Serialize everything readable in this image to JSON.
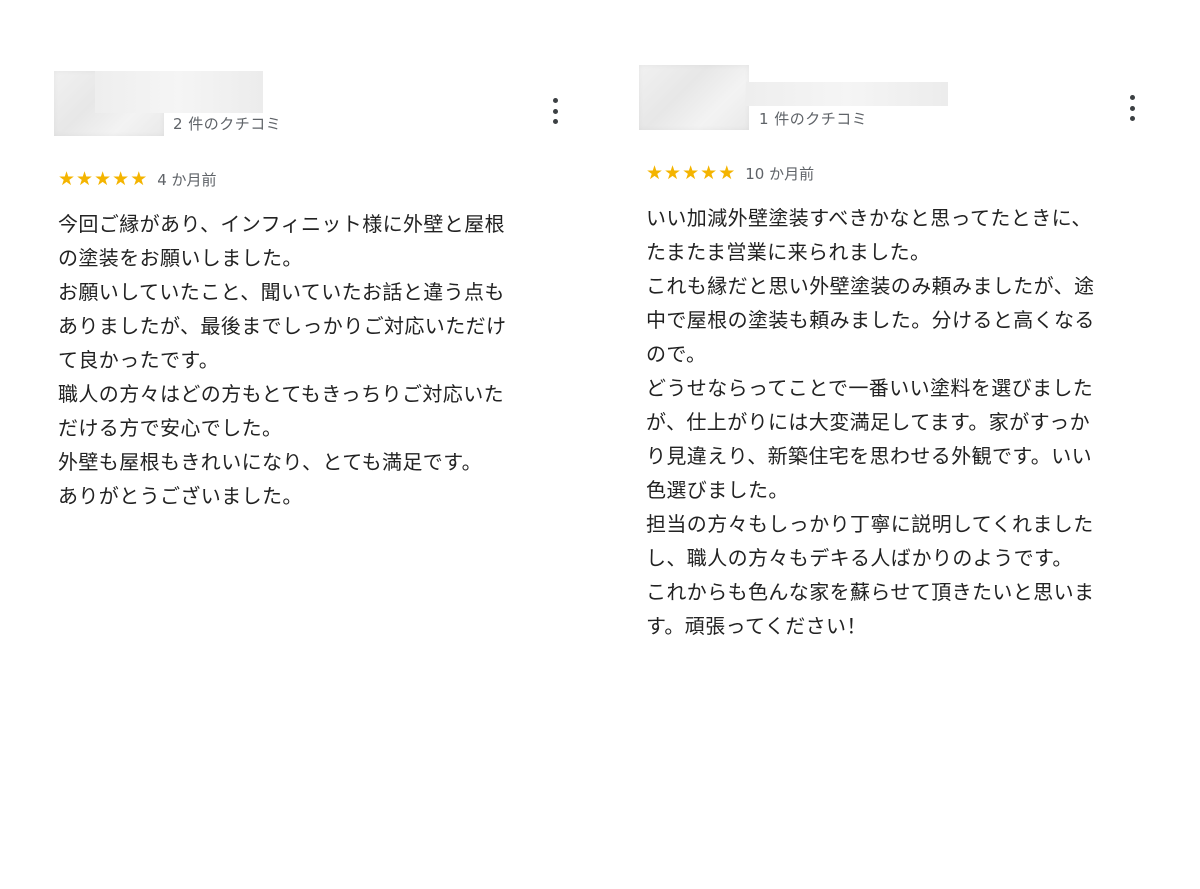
{
  "reviews": [
    {
      "review_count": "2 件のクチコミ",
      "rating": 5,
      "date": "4 か月前",
      "lines": [
        "今回ご縁があり、インフィニット様に外壁と屋根",
        "の塗装をお願いしました。",
        "お願いしていたこと、聞いていたお話と違う点も",
        "ありましたが、最後までしっかりご対応いただけ",
        "て良かったです。",
        "職人の方々はどの方もとてもきっちりご対応いた",
        "だける方で安心でした。",
        "外壁も屋根もきれいになり、とても満足です。",
        "ありがとうございました。"
      ]
    },
    {
      "review_count": "1 件のクチコミ",
      "rating": 5,
      "date": "10 か月前",
      "lines": [
        "いい加減外壁塗装すべきかなと思ってたときに、",
        "たまたま営業に来られました。",
        "これも縁だと思い外壁塗装のみ頼みましたが、途",
        "中で屋根の塗装も頼みました。分けると高くなる",
        "ので。",
        "どうせならってことで一番いい塗料を選びました",
        "が、仕上がりには大変満足してます。家がすっか",
        "り見違えり、新築住宅を思わせる外観です。いい",
        "色選びました。",
        "担当の方々もしっかり丁寧に説明してくれました",
        "し、職人の方々もデキる人ばかりのようです。",
        "これからも色んな家を蘇らせて頂きたいと思いま",
        "す。頑張ってください！"
      ]
    }
  ],
  "icons": {
    "star": "★",
    "star_color": "#f4b400",
    "menu": "more-vert-icon"
  }
}
